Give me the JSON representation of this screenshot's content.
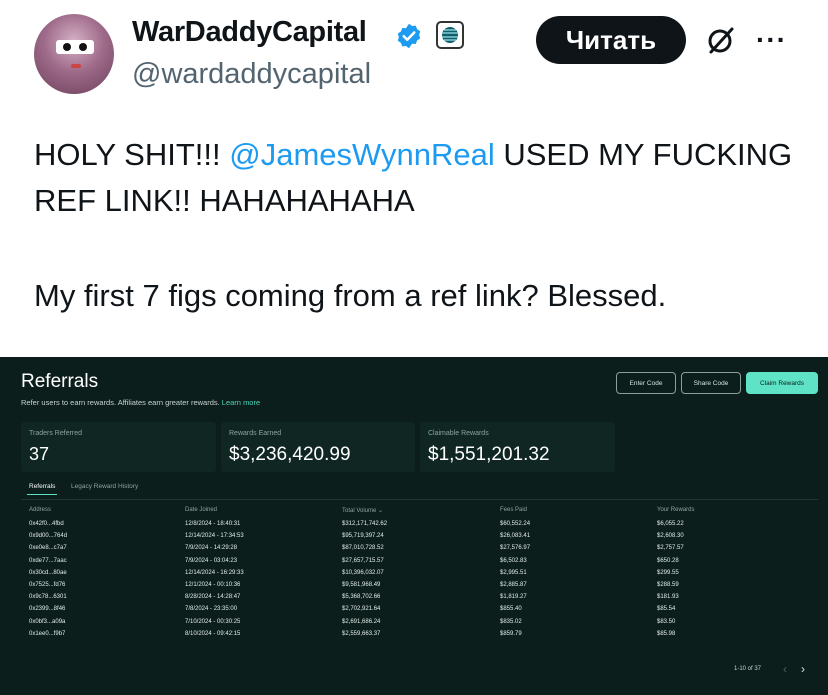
{
  "tweet": {
    "display_name": "WarDaddyCapital",
    "handle": "@wardaddycapital",
    "read_button_label": "Читать",
    "more_label": "···",
    "text_prefix": "HOLY SHIT!!! ",
    "mention": "@JamesWynnReal",
    "text_suffix": " USED MY FUCKING REF LINK!! HAHAHAHAHA",
    "text_line2": "My first 7 figs coming from a ref link? Blessed.",
    "colors": {
      "mention": "#1d9bf0",
      "verified_badge": "#1d9bf0",
      "read_button": "#0f1419"
    }
  },
  "dashboard": {
    "title": "Referrals",
    "subtitle": "Refer users to earn rewards. Affiliates earn greater rewards. ",
    "learn_more": "Learn more",
    "buttons": {
      "enter_code": "Enter Code",
      "share_code": "Share Code",
      "claim_rewards": "Claim Rewards"
    },
    "stats": {
      "traders_referred_label": "Traders Referred",
      "traders_referred": "37",
      "rewards_earned_label": "Rewards Earned",
      "rewards_earned": "$3,236,420.99",
      "claimable_label": "Claimable Rewards",
      "claimable": "$1,551,201.32"
    },
    "tabs": {
      "referrals": "Referrals",
      "legacy": "Legacy Reward History"
    },
    "columns": {
      "address": "Address",
      "date_joined": "Date Joined",
      "total_volume": "Total Volume ⌄",
      "fees_paid": "Fees Paid",
      "your_rewards": "Your Rewards"
    },
    "rows": [
      {
        "address": "0x42f0...4fbd",
        "date": "12/8/2024 - 18:40:31",
        "volume": "$312,171,742.62",
        "fees": "$60,552.24",
        "rewards": "$6,055.22"
      },
      {
        "address": "0x9d00...764d",
        "date": "12/14/2024 - 17:34:53",
        "volume": "$95,719,397.24",
        "fees": "$26,083.41",
        "rewards": "$2,608.30"
      },
      {
        "address": "0xe0e8...c7a7",
        "date": "7/9/2024 - 14:29:28",
        "volume": "$87,010,728.52",
        "fees": "$27,576.97",
        "rewards": "$2,757.57"
      },
      {
        "address": "0xde77...7aac",
        "date": "7/9/2024 - 03:04:23",
        "volume": "$27,657,715.57",
        "fees": "$6,502.83",
        "rewards": "$650.28"
      },
      {
        "address": "0x30cd...80ae",
        "date": "12/14/2024 - 16:29:33",
        "volume": "$10,396,032.07",
        "fees": "$2,995.51",
        "rewards": "$299.55"
      },
      {
        "address": "0x7525...fd76",
        "date": "12/1/2024 - 00:10:36",
        "volume": "$9,581,968.49",
        "fees": "$2,885.87",
        "rewards": "$288.59"
      },
      {
        "address": "0x9c78...6301",
        "date": "8/28/2024 - 14:28:47",
        "volume": "$5,368,702.66",
        "fees": "$1,819.27",
        "rewards": "$181.93"
      },
      {
        "address": "0x2399...8f46",
        "date": "7/8/2024 - 23:35:00",
        "volume": "$2,702,921.64",
        "fees": "$855.40",
        "rewards": "$85.54"
      },
      {
        "address": "0x0bf3...a09a",
        "date": "7/10/2024 - 00:30:25",
        "volume": "$2,691,686.24",
        "fees": "$835.02",
        "rewards": "$83.50"
      },
      {
        "address": "0x1ee0...f9b7",
        "date": "8/10/2024 - 09:42:15",
        "volume": "$2,559,663.37",
        "fees": "$859.79",
        "rewards": "$85.98"
      }
    ],
    "pagination": "1-10 of 37",
    "colors": {
      "background": "#0b1e1b",
      "accent": "#5fe3c6"
    }
  }
}
